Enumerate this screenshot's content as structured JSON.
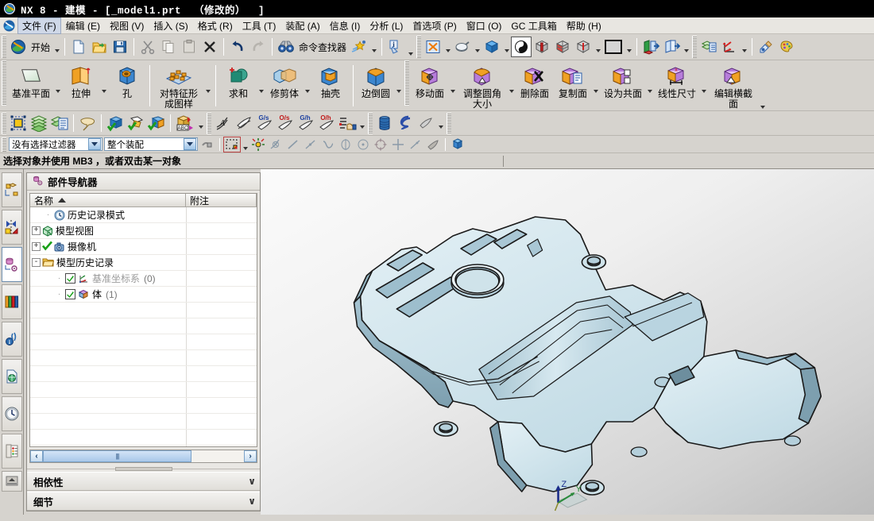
{
  "window": {
    "title": "NX 8 - 建模 - [_model1.prt  （修改的）  ]",
    "app_icon": "nx-logo-icon"
  },
  "menubar": {
    "app_icon": "nx-app-icon",
    "items": [
      {
        "label": "文件 (F)",
        "active": true
      },
      {
        "label": "编辑 (E)",
        "active": false
      },
      {
        "label": "视图 (V)",
        "active": false
      },
      {
        "label": "插入 (S)",
        "active": false
      },
      {
        "label": "格式 (R)",
        "active": false
      },
      {
        "label": "工具 (T)",
        "active": false
      },
      {
        "label": "装配 (A)",
        "active": false
      },
      {
        "label": "信息 (I)",
        "active": false
      },
      {
        "label": "分析 (L)",
        "active": false
      },
      {
        "label": "首选项 (P)",
        "active": false
      },
      {
        "label": "窗口 (O)",
        "active": false
      },
      {
        "label": "GC 工具箱",
        "active": false
      },
      {
        "label": "帮助 (H)",
        "active": false
      }
    ]
  },
  "standard_toolbar": {
    "start_label": "开始",
    "command_finder_label": "命令查找器",
    "buttons": [
      {
        "name": "start-button",
        "icon": "nx-start-icon"
      },
      {
        "name": "new-button",
        "icon": "new-document-icon"
      },
      {
        "name": "open-button",
        "icon": "open-folder-icon"
      },
      {
        "name": "save-button",
        "icon": "floppy-save-icon"
      },
      {
        "name": "cut-button",
        "icon": "scissors-icon"
      },
      {
        "name": "copy-button",
        "icon": "copy-icon"
      },
      {
        "name": "paste-button",
        "icon": "paste-icon"
      },
      {
        "name": "delete-button",
        "icon": "x-delete-icon"
      },
      {
        "name": "undo-button",
        "icon": "undo-arrow-icon"
      },
      {
        "name": "redo-button",
        "icon": "redo-arrow-icon"
      },
      {
        "name": "command-finder-button",
        "icon": "binoculars-icon"
      },
      {
        "name": "customize-button",
        "icon": "star-wand-icon"
      },
      {
        "name": "info-button",
        "icon": "info-tag-icon"
      },
      {
        "name": "fit-view-button",
        "icon": "fit-window-icon"
      },
      {
        "name": "zoom-button",
        "icon": "zoom-magnifier-icon"
      },
      {
        "name": "rotate-button",
        "icon": "blue-cube-icon"
      },
      {
        "name": "shaded-with-edges-button",
        "icon": "shaded-sphere-icon",
        "pressed": true
      },
      {
        "name": "section-x-button",
        "icon": "clip-cube-red-icon"
      },
      {
        "name": "section-y-button",
        "icon": "clip-cube-grid-icon"
      },
      {
        "name": "section-z-button",
        "icon": "clip-cube-solid-icon"
      },
      {
        "name": "view-section-button",
        "icon": "cube-pin-icon"
      },
      {
        "name": "background-button",
        "icon": "background-swatch-icon"
      },
      {
        "name": "layer-visible-button",
        "icon": "layer-green-arrow-icon"
      },
      {
        "name": "layer-settings-button",
        "icon": "layer-arrow-icon"
      },
      {
        "name": "layer-list-button",
        "icon": "layer-stack-list-icon"
      },
      {
        "name": "wcs-button",
        "icon": "wcs-axes-icon"
      },
      {
        "name": "material-button",
        "icon": "material-brush-icon"
      },
      {
        "name": "render-button",
        "icon": "palette-render-icon"
      }
    ]
  },
  "ribbon": {
    "groups": [
      {
        "buttons": [
          {
            "label": "基准平面",
            "icon": "datum-plane-icon",
            "caret": true
          },
          {
            "label": "拉伸",
            "icon": "extrude-icon",
            "caret": true
          },
          {
            "label": "孔",
            "icon": "hole-icon",
            "caret": false
          }
        ]
      },
      {
        "buttons": [
          {
            "label": "对特征形成图样",
            "icon": "pattern-feature-icon",
            "caret": true,
            "two_line": true
          }
        ]
      },
      {
        "buttons": [
          {
            "label": "求和",
            "icon": "unite-icon",
            "caret": true
          },
          {
            "label": "修剪体",
            "icon": "trim-body-icon",
            "caret": true
          },
          {
            "label": "抽壳",
            "icon": "shell-icon",
            "caret": false
          }
        ]
      },
      {
        "buttons": [
          {
            "label": "边倒圆",
            "icon": "edge-blend-icon",
            "caret": true
          }
        ]
      },
      {
        "buttons": [
          {
            "label": "移动面",
            "icon": "move-face-icon",
            "caret": true
          },
          {
            "label": "调整圆角大小",
            "icon": "resize-blend-icon",
            "caret": true,
            "two_line": true
          },
          {
            "label": "删除面",
            "icon": "delete-face-icon",
            "caret": false
          },
          {
            "label": "复制面",
            "icon": "copy-face-icon",
            "caret": true
          },
          {
            "label": "设为共面",
            "icon": "make-coplanar-icon",
            "caret": true
          },
          {
            "label": "线性尺寸",
            "icon": "linear-dimension-icon",
            "caret": true
          },
          {
            "label": "编辑横截面",
            "icon": "edit-section-icon",
            "caret": true,
            "two_line": true
          }
        ]
      }
    ]
  },
  "utility_toolbar": {
    "buttons": [
      {
        "name": "sketch-button",
        "icon": "sketch-frame-icon"
      },
      {
        "name": "layers-button",
        "icon": "layer-stack-icon"
      },
      {
        "name": "layer-category-button",
        "icon": "layer-list-icon"
      },
      {
        "name": "note-button",
        "icon": "note-tag-icon"
      },
      {
        "name": "check-geometry-button",
        "icon": "cube-check-blue-icon"
      },
      {
        "name": "check-face-button",
        "icon": "face-check-icon"
      },
      {
        "name": "check-body-button",
        "icon": "body-check-icon"
      },
      {
        "name": "abc-label-button",
        "icon": "abc-cube-icon"
      },
      {
        "name": "analysis-a-button",
        "icon": "curvature-a-icon"
      },
      {
        "name": "analysis-face-button",
        "icon": "face-analysis-icon"
      },
      {
        "name": "gs-button",
        "icon": "gs-surface-icon",
        "badge": "G/s"
      },
      {
        "name": "os-button",
        "icon": "os-surface-icon",
        "badge": "O/s"
      },
      {
        "name": "gh-button",
        "icon": "gh-surface-icon",
        "badge": "G/h"
      },
      {
        "name": "oh-button",
        "icon": "oh-surface-icon",
        "badge": "O/h"
      },
      {
        "name": "list-point-button",
        "icon": "list-hand-icon"
      },
      {
        "name": "cylinder-button",
        "icon": "blue-cylinder-icon"
      },
      {
        "name": "spring-button",
        "icon": "spring-coil-icon"
      },
      {
        "name": "shade-button",
        "icon": "shade-grey-icon"
      }
    ]
  },
  "selection_bar": {
    "filter": {
      "value": "没有选择过滤器",
      "name": "selection-filter-combo"
    },
    "scope": {
      "value": "整个装配",
      "name": "selection-scope-combo"
    },
    "buttons": [
      {
        "name": "select-general-button",
        "icon": "select-chain-icon"
      },
      {
        "name": "rectangle-select-button",
        "icon": "rectangle-select-icon",
        "caret": true
      },
      {
        "name": "snap-point-enable-button",
        "icon": "snap-point-icon"
      },
      {
        "name": "snap-end-button",
        "icon": "snap-endpoint-icon"
      },
      {
        "name": "snap-line-button",
        "icon": "snap-line-icon"
      },
      {
        "name": "snap-midpoint-button",
        "icon": "snap-midpoint-icon"
      },
      {
        "name": "snap-tangent-button",
        "icon": "snap-tangent-icon"
      },
      {
        "name": "snap-quadrant-button",
        "icon": "snap-quadrant-icon"
      },
      {
        "name": "snap-center-button",
        "icon": "snap-center-icon"
      },
      {
        "name": "snap-arc-center-button",
        "icon": "snap-arc-center-icon"
      },
      {
        "name": "snap-intersection-button",
        "icon": "snap-intersection-icon"
      },
      {
        "name": "snap-on-curve-button",
        "icon": "snap-on-curve-icon"
      },
      {
        "name": "snap-face-button",
        "icon": "snap-face-icon"
      },
      {
        "name": "snap-cube-button",
        "icon": "snap-cube-icon"
      }
    ]
  },
  "status": {
    "cue_text": "选择对象并使用  MB3 ，或者双击某一对象"
  },
  "resource_bar": {
    "items": [
      {
        "name": "assembly-navigator-icon",
        "label": "装配导航器"
      },
      {
        "name": "constraint-navigator-icon",
        "label": "约束导航器"
      },
      {
        "name": "part-navigator-icon",
        "label": "部件导航器",
        "selected": true
      },
      {
        "name": "reuse-library-icon",
        "label": "重用库"
      },
      {
        "name": "hd3d-tools-icon",
        "label": "HD3D 工具"
      },
      {
        "name": "web-browser-icon",
        "label": "Web 浏览器"
      },
      {
        "name": "history-icon",
        "label": "历史记录"
      },
      {
        "name": "roles-icon",
        "label": "角色"
      },
      {
        "name": "system-materials-icon",
        "label": "系统材料"
      }
    ]
  },
  "navigator": {
    "title": "部件导航器",
    "title_icon": "part-navigator-icon",
    "columns": [
      {
        "label": "名称",
        "sorted": true
      },
      {
        "label": "附注",
        "sorted": false
      }
    ],
    "rows": [
      {
        "label": "历史记录模式",
        "icon": "clock-icon",
        "indent": 1,
        "expander": null,
        "check": null,
        "count": null,
        "grey": false
      },
      {
        "label": "模型视图",
        "icon": "model-views-icon",
        "indent": 0,
        "expander": "+",
        "check": null,
        "count": null,
        "grey": false
      },
      {
        "label": "摄像机",
        "icon": "camera-icon",
        "indent": 0,
        "expander": "+",
        "check": "green",
        "count": null,
        "grey": false
      },
      {
        "label": "模型历史记录",
        "icon": "folder-icon",
        "indent": 0,
        "expander": "-",
        "check": null,
        "count": null,
        "grey": false
      },
      {
        "label": "基准坐标系",
        "icon": "datum-csys-icon",
        "indent": 2,
        "expander": null,
        "check": "box",
        "count": "(0)",
        "grey": true
      },
      {
        "label": "体",
        "icon": "body-icon",
        "indent": 2,
        "expander": null,
        "check": "box",
        "count": "(1)",
        "grey": false
      }
    ],
    "scrollbar": {
      "left_arrow": "‹",
      "right_arrow": "›"
    },
    "sections": [
      {
        "label": "相依性",
        "chevron": "∨"
      },
      {
        "label": "细节",
        "chevron": "∨"
      }
    ]
  },
  "graphics": {
    "triad": {
      "z_label": "Z",
      "y_label": "Y",
      "x_label": "X"
    },
    "model_name": "sheet-metal-bracket",
    "colors": {
      "part_light": "#d6e8ef",
      "part_mid": "#bcd6e1",
      "part_dark": "#8fb1bf",
      "edge": "#1a1a1a",
      "bg_light": "#fafafa",
      "bg_dark": "#bdbdbd"
    }
  }
}
